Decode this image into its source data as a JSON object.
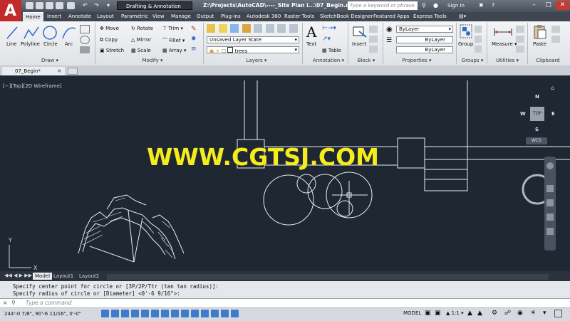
{
  "titlebar": {
    "workspace": "Drafting & Annotation",
    "file_title": "Z:\\Projects\\AutoCAD\\----_Site Plan i...\\07_Begin.dwg",
    "search_placeholder": "Type a keyword or phrase",
    "sign_in": "Sign In"
  },
  "menu_tabs": [
    "Home",
    "Insert",
    "Annotate",
    "Layout",
    "Parametric",
    "View",
    "Manage",
    "Output",
    "Plug-ins",
    "Autodesk 360",
    "Raster Tools",
    "SketchBook Designer",
    "Featured Apps",
    "Express Tools"
  ],
  "ribbon": {
    "draw": {
      "title": "Draw",
      "tools": [
        "Line",
        "Polyline",
        "Circle",
        "Arc"
      ]
    },
    "modify": {
      "title": "Modify",
      "tools": [
        "Move",
        "Rotate",
        "Trim",
        "Copy",
        "Mirror",
        "Fillet",
        "Stretch",
        "Scale",
        "Array"
      ]
    },
    "layers": {
      "title": "Layers",
      "layer_state": "Unsaved Layer State",
      "current_layer": "trees"
    },
    "annotation": {
      "title": "Annotation",
      "tools": [
        "Text",
        "Table"
      ]
    },
    "block": {
      "title": "Block",
      "tools": [
        "Insert"
      ]
    },
    "properties": {
      "title": "Properties",
      "color": "ByLayer",
      "linetype": "ByLayer",
      "lineweight": "ByLayer"
    },
    "groups": {
      "title": "Groups",
      "tools": [
        "Group"
      ]
    },
    "utilities": {
      "title": "Utilities",
      "tools": [
        "Measure"
      ]
    },
    "clipboard": {
      "title": "Clipboard",
      "tools": [
        "Paste"
      ]
    }
  },
  "file_tab": "07_Begin*",
  "viewport": {
    "label": "[−][Top][2D Wireframe]",
    "viewcube": {
      "top": "TOP",
      "north": "N",
      "south": "S",
      "east": "E",
      "west": "W",
      "wcs": "WCS"
    }
  },
  "watermark": "WWW.CGTSJ.COM",
  "layout_tabs": [
    "Model",
    "Layout1",
    "Layout2"
  ],
  "command": {
    "history": [
      "Specify center point for circle or [3P/2P/Ttr (tan tan radius)]:",
      "Specify radius of circle or [Diameter] <0'-6 9/16\">:"
    ],
    "placeholder": "Type a command"
  },
  "statusbar": {
    "coords": "244'-0 7/8\", 90'-6 11/16\", 0'-0\"",
    "model": "MODEL",
    "scale": "1:1"
  },
  "colors": {
    "canvas": "#1f2733",
    "accent": "#c32a2a",
    "watermark": "#f5ec1c"
  }
}
